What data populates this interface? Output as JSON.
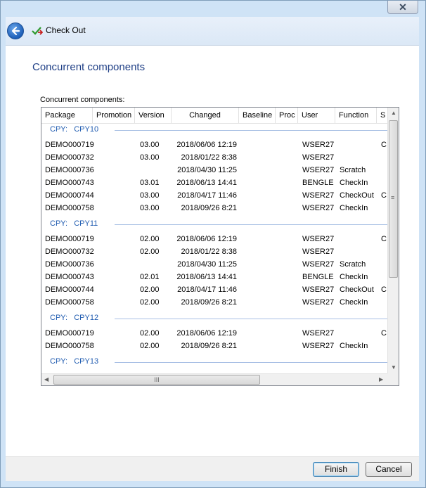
{
  "window": {
    "title": "Check Out",
    "close_glyph": "✕"
  },
  "page": {
    "heading": "Concurrent components",
    "group_label": "Concurrent components:"
  },
  "columns": [
    "Package",
    "Promotion",
    "Version",
    "Changed",
    "Baseline",
    "Proc",
    "User",
    "Function",
    "S"
  ],
  "groups": [
    {
      "label": "CPY:   CPY10",
      "rows": [
        {
          "package": "DEMO000719",
          "version": "03.00",
          "changed": "2018/06/06  12:19",
          "user": "WSER27",
          "function": "",
          "s": "C"
        },
        {
          "package": "DEMO000732",
          "version": "03.00",
          "changed": "2018/01/22  8:38",
          "user": "WSER27",
          "function": "",
          "s": ""
        },
        {
          "package": "DEMO000736",
          "version": "",
          "changed": "2018/04/30  11:25",
          "user": "WSER27",
          "function": "Scratch",
          "s": ""
        },
        {
          "package": "DEMO000743",
          "version": "03.01",
          "changed": "2018/06/13  14:41",
          "user": "BENGLE",
          "function": "CheckIn",
          "s": ""
        },
        {
          "package": "DEMO000744",
          "version": "03.00",
          "changed": "2018/04/17  11:46",
          "user": "WSER27",
          "function": "CheckOut",
          "s": "C"
        },
        {
          "package": "DEMO000758",
          "version": "03.00",
          "changed": "2018/09/26  8:21",
          "user": "WSER27",
          "function": "CheckIn",
          "s": ""
        }
      ]
    },
    {
      "label": "CPY:   CPY11",
      "rows": [
        {
          "package": "DEMO000719",
          "version": "02.00",
          "changed": "2018/06/06  12:19",
          "user": "WSER27",
          "function": "",
          "s": "C"
        },
        {
          "package": "DEMO000732",
          "version": "02.00",
          "changed": "2018/01/22  8:38",
          "user": "WSER27",
          "function": "",
          "s": ""
        },
        {
          "package": "DEMO000736",
          "version": "",
          "changed": "2018/04/30  11:25",
          "user": "WSER27",
          "function": "Scratch",
          "s": ""
        },
        {
          "package": "DEMO000743",
          "version": "02.01",
          "changed": "2018/06/13  14:41",
          "user": "BENGLE",
          "function": "CheckIn",
          "s": ""
        },
        {
          "package": "DEMO000744",
          "version": "02.00",
          "changed": "2018/04/17  11:46",
          "user": "WSER27",
          "function": "CheckOut",
          "s": "C"
        },
        {
          "package": "DEMO000758",
          "version": "02.00",
          "changed": "2018/09/26  8:21",
          "user": "WSER27",
          "function": "CheckIn",
          "s": ""
        }
      ]
    },
    {
      "label": "CPY:   CPY12",
      "rows": [
        {
          "package": "DEMO000719",
          "version": "02.00",
          "changed": "2018/06/06  12:19",
          "user": "WSER27",
          "function": "",
          "s": "C"
        },
        {
          "package": "DEMO000758",
          "version": "02.00",
          "changed": "2018/09/26  8:21",
          "user": "WSER27",
          "function": "CheckIn",
          "s": ""
        }
      ]
    },
    {
      "label": "CPY:   CPY13",
      "rows": []
    }
  ],
  "scroll": {
    "grip": "III",
    "left": "◀",
    "right": "▶",
    "up": "▲",
    "down": "▼",
    "vgrip": "≡"
  },
  "buttons": {
    "finish": "Finish",
    "cancel": "Cancel"
  }
}
